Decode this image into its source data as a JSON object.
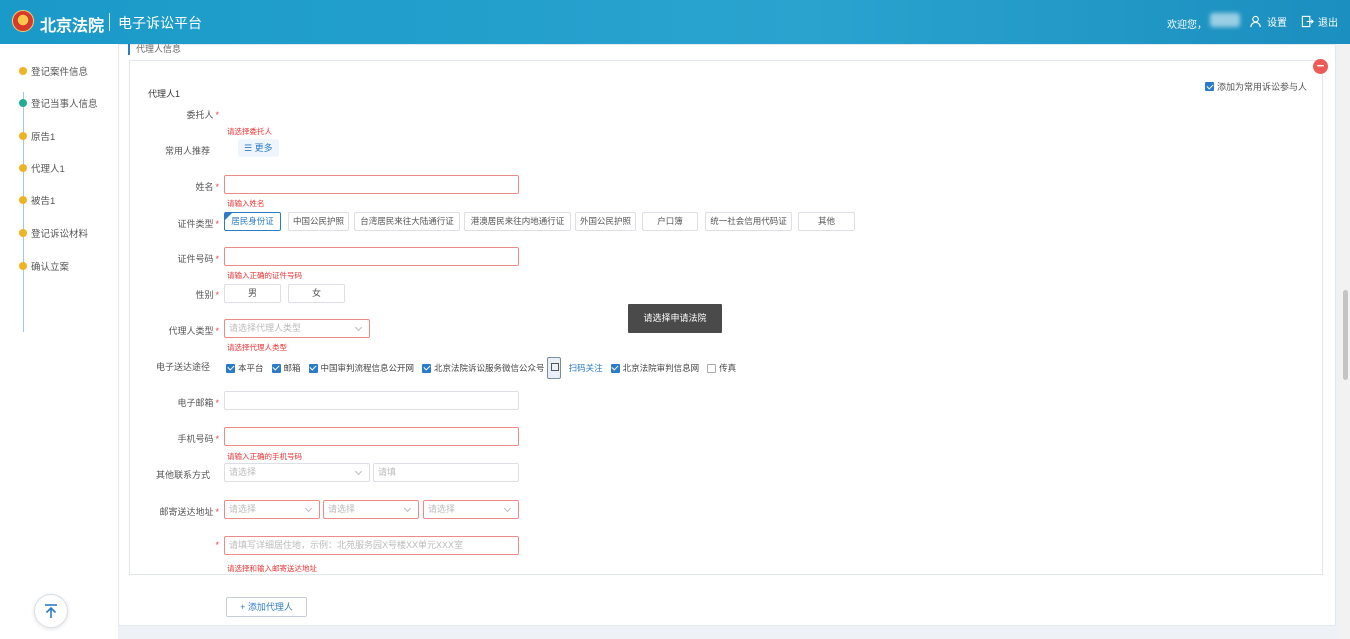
{
  "header": {
    "brand": "北京法院",
    "platform": "电子诉讼平台",
    "welcome": "欢迎您，",
    "settings_label": "设置",
    "logout_label": "退出"
  },
  "sidebar": {
    "steps": [
      {
        "label": "登记案件信息",
        "status": "done"
      },
      {
        "label": "登记当事人信息",
        "status": "active"
      },
      {
        "label": "原告1",
        "status": "done"
      },
      {
        "label": "代理人1",
        "status": "done"
      },
      {
        "label": "被告1",
        "status": "done"
      },
      {
        "label": "登记诉讼材料",
        "status": "done"
      },
      {
        "label": "确认立案",
        "status": "done"
      }
    ],
    "back_to_top_icon": "arrow-up-icon"
  },
  "section_title": "代理人信息",
  "card": {
    "title": "代理人1",
    "favorite_label": "添加为常用诉讼参与人",
    "favorite_checked": true,
    "principal": {
      "label": "委托人",
      "error": "请选择委托人"
    },
    "recommend": {
      "label": "常用人推荐",
      "more": "更多"
    },
    "name": {
      "label": "姓名",
      "value": "",
      "error": "请输入姓名"
    },
    "id_type": {
      "label": "证件类型",
      "options": [
        "居民身份证",
        "中国公民护照",
        "台湾居民来往大陆通行证",
        "港澳居民来往内地通行证",
        "外国公民护照",
        "户口簿",
        "统一社会信用代码证",
        "其他"
      ],
      "selected": "居民身份证"
    },
    "id_number": {
      "label": "证件号码",
      "value": "",
      "error": "请输入正确的证件号码"
    },
    "gender": {
      "label": "性别",
      "options": [
        "男",
        "女"
      ]
    },
    "agent_type": {
      "label": "代理人类型",
      "placeholder": "请选择代理人类型",
      "error": "请选择代理人类型"
    },
    "delivery": {
      "label": "电子送达途径",
      "options": [
        {
          "label": "本平台",
          "checked": true
        },
        {
          "label": "邮箱",
          "checked": true
        },
        {
          "label": "中国审判流程信息公开网",
          "checked": true
        },
        {
          "label": "北京法院诉讼服务微信公众号",
          "checked": true
        },
        {
          "label": "北京法院审判信息网",
          "checked": true
        },
        {
          "label": "传真",
          "checked": false
        }
      ],
      "scan_label": "扫码关注"
    },
    "email": {
      "label": "电子邮箱",
      "value": ""
    },
    "phone": {
      "label": "手机号码",
      "value": "",
      "error": "请输入正确的手机号码"
    },
    "other_contact": {
      "label": "其他联系方式",
      "select_placeholder": "请选择",
      "input_placeholder": "请填"
    },
    "address": {
      "label": "邮寄送达地址",
      "select1": "请选择",
      "select2": "请选择",
      "select3": "请选择",
      "detail_placeholder": "请填写详细居住地，示例：北苑服务园X号楼XX单元XXX室",
      "error": "请选择和输入邮寄送达地址"
    }
  },
  "tooltip": "请选择申请法院",
  "add_agent_label": "+ 添加代理人"
}
